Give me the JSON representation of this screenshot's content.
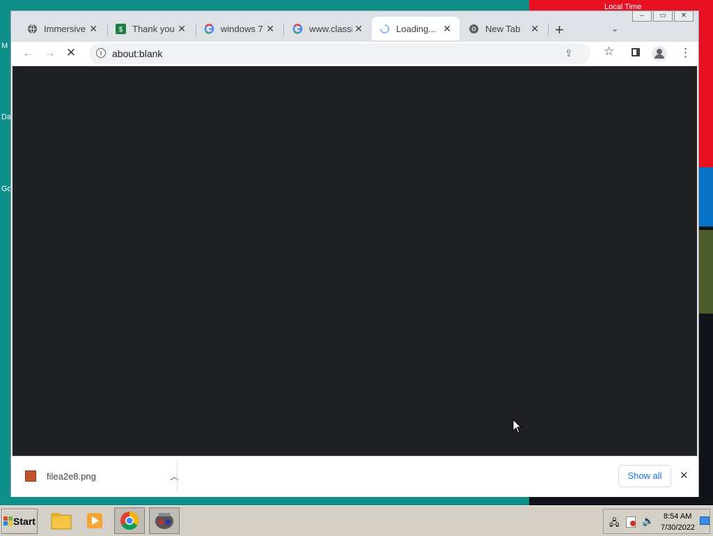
{
  "desktop": {
    "local_time_label": "Local Time",
    "left_labels": [
      "M",
      "Da",
      "Go"
    ]
  },
  "browser": {
    "tabs": [
      {
        "title": "Immersive Reader",
        "icon": "globe-icon",
        "active": false
      },
      {
        "title": "Thank you for",
        "icon": "dollar-icon",
        "active": false
      },
      {
        "title": "windows 7",
        "icon": "google-icon",
        "active": false
      },
      {
        "title": "www.classic",
        "icon": "google-icon",
        "active": false
      },
      {
        "title": "Loading...",
        "icon": "spinner-icon",
        "active": true
      },
      {
        "title": "New Tab",
        "icon": "chrome-icon",
        "active": false
      }
    ],
    "new_tab_symbol": "+",
    "address": "about:blank",
    "page_background": "#202124"
  },
  "download_bar": {
    "filename": "filea2e8.png",
    "show_all_label": "Show all"
  },
  "taskbar": {
    "start_label": "Start",
    "time": "8:54 AM",
    "date": "7/30/2022"
  }
}
